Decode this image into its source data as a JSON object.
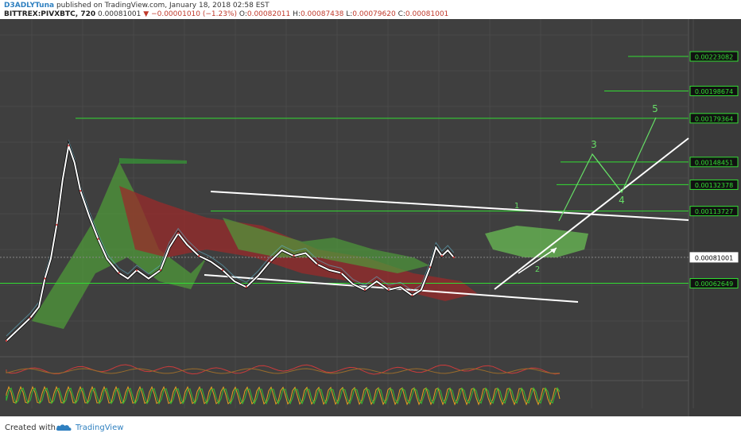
{
  "header": {
    "author": "D3ADLYTuna",
    "published_text": "published on TradingView.com, January 18, 2018 02:58 EST",
    "exchange_symbol": "BITTREX:PIVXBTC, 720",
    "last_price": "0.00081001",
    "change": "−0.00001010 (−1.23%)",
    "open_label": "O:",
    "open": "0.00082011",
    "high_label": "H:",
    "high": "0.00087438",
    "low_label": "L:",
    "low": "0.00079620",
    "close_label": "C:",
    "close": "0.00081001"
  },
  "footer": {
    "created_with": "Created with",
    "brand": "TradingView"
  },
  "colors": {
    "background": "#3f3f3f",
    "target_green": "#33dd33",
    "wave_green": "#66dd66",
    "channel_white": "#ffffff",
    "current_price_bg": "#ffffff"
  },
  "chart_data": {
    "type": "line",
    "price_axis_levels": [
      "0.00223082",
      "0.00198674",
      "0.00179364",
      "0.00148451",
      "0.00132378",
      "0.00113727",
      "0.00081001",
      "0.00062649"
    ],
    "current_price": "0.00081001",
    "wave_labels": [
      "1",
      "2",
      "3",
      "4",
      "5"
    ],
    "price_series": [
      {
        "x": 0,
        "y": 0.00022
      },
      {
        "x": 4,
        "y": 0.0003
      },
      {
        "x": 8,
        "y": 0.00038
      },
      {
        "x": 11,
        "y": 0.00046
      },
      {
        "x": 13,
        "y": 0.00066
      },
      {
        "x": 15,
        "y": 0.0008
      },
      {
        "x": 17,
        "y": 0.00104
      },
      {
        "x": 19,
        "y": 0.00136
      },
      {
        "x": 21,
        "y": 0.0016
      },
      {
        "x": 23,
        "y": 0.00148
      },
      {
        "x": 25,
        "y": 0.00128
      },
      {
        "x": 28,
        "y": 0.0011
      },
      {
        "x": 31,
        "y": 0.00094
      },
      {
        "x": 34,
        "y": 0.0008
      },
      {
        "x": 38,
        "y": 0.0007
      },
      {
        "x": 41,
        "y": 0.00066
      },
      {
        "x": 44,
        "y": 0.00072
      },
      {
        "x": 48,
        "y": 0.00066
      },
      {
        "x": 52,
        "y": 0.00072
      },
      {
        "x": 55,
        "y": 0.00088
      },
      {
        "x": 58,
        "y": 0.00098
      },
      {
        "x": 61,
        "y": 0.0009
      },
      {
        "x": 65,
        "y": 0.00082
      },
      {
        "x": 69,
        "y": 0.00078
      },
      {
        "x": 73,
        "y": 0.00072
      },
      {
        "x": 77,
        "y": 0.00064
      },
      {
        "x": 81,
        "y": 0.0006
      },
      {
        "x": 85,
        "y": 0.00068
      },
      {
        "x": 89,
        "y": 0.00078
      },
      {
        "x": 93,
        "y": 0.00086
      },
      {
        "x": 97,
        "y": 0.00082
      },
      {
        "x": 101,
        "y": 0.00084
      },
      {
        "x": 105,
        "y": 0.00076
      },
      {
        "x": 109,
        "y": 0.00072
      },
      {
        "x": 113,
        "y": 0.0007
      },
      {
        "x": 117,
        "y": 0.00062
      },
      {
        "x": 121,
        "y": 0.00058
      },
      {
        "x": 125,
        "y": 0.00064
      },
      {
        "x": 129,
        "y": 0.00058
      },
      {
        "x": 133,
        "y": 0.0006
      },
      {
        "x": 137,
        "y": 0.00054
      },
      {
        "x": 140,
        "y": 0.00058
      },
      {
        "x": 143,
        "y": 0.00074
      },
      {
        "x": 145,
        "y": 0.00088
      },
      {
        "x": 147,
        "y": 0.00082
      },
      {
        "x": 149,
        "y": 0.00086
      },
      {
        "x": 151,
        "y": 0.00081
      }
    ],
    "xlim": [
      0,
      190
    ],
    "ylim": [
      0.00018,
      0.00245
    ]
  }
}
